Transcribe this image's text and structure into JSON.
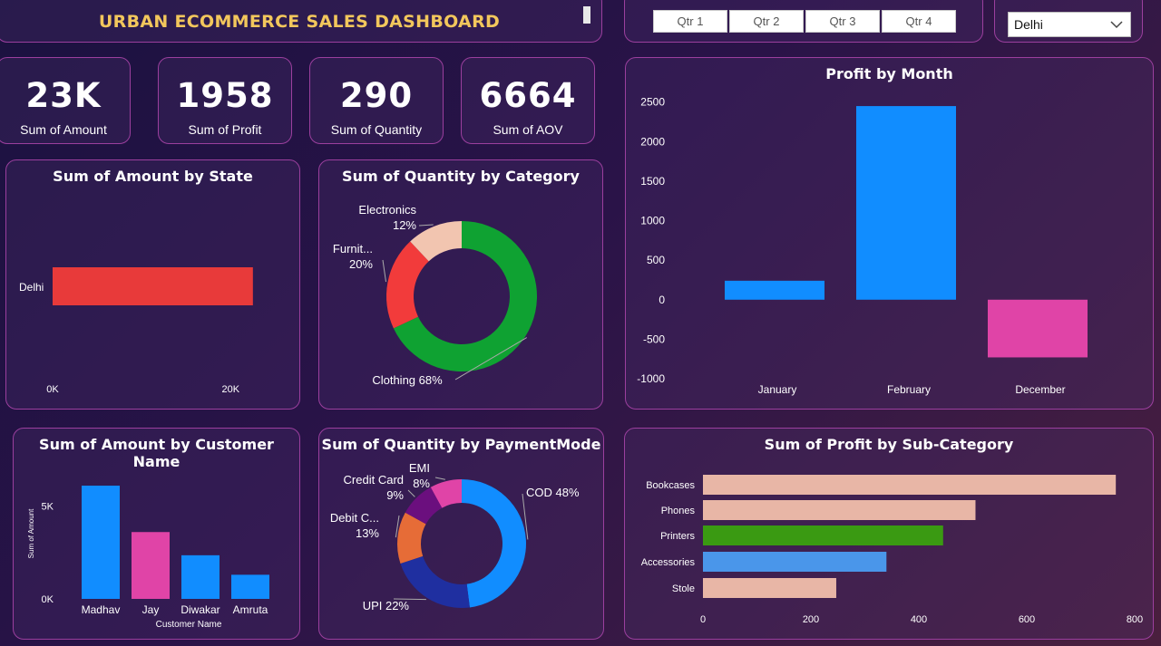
{
  "header": {
    "title": "URBAN ECOMMERCE SALES DASHBOARD",
    "quarters": [
      "Qtr 1",
      "Qtr 2",
      "Qtr 3",
      "Qtr 4"
    ],
    "city_selected": "Delhi"
  },
  "kpis": [
    {
      "value": "23K",
      "label": "Sum of Amount"
    },
    {
      "value": "1958",
      "label": "Sum of Profit"
    },
    {
      "value": "290",
      "label": "Sum of Quantity"
    },
    {
      "value": "6664",
      "label": "Sum of AOV"
    }
  ],
  "colors": {
    "blue": "#118dff",
    "pink": "#e044a7",
    "red": "#e83a3a",
    "green": "#0fa232",
    "peach": "#f2c5b0",
    "title_gold": "#f2c75c"
  },
  "chart_data": [
    {
      "id": "state",
      "type": "bar",
      "orientation": "horizontal",
      "title": "Sum of Amount by State",
      "categories": [
        "Delhi"
      ],
      "values": [
        22500
      ],
      "xlim": [
        0,
        27000
      ],
      "xticks": [
        {
          "v": 0,
          "label": "0K"
        },
        {
          "v": 20000,
          "label": "20K"
        }
      ],
      "colors": [
        "#e83a3a"
      ]
    },
    {
      "id": "category",
      "type": "pie",
      "donut": true,
      "title": "Sum of Quantity by Category",
      "slices": [
        {
          "name": "Clothing",
          "pct": 68,
          "label": "Clothing 68%",
          "color": "#0fa232"
        },
        {
          "name": "Furnit...",
          "pct": 20,
          "label": "20%",
          "color": "#f23b3b"
        },
        {
          "name": "Electronics",
          "pct": 12,
          "label": "12%",
          "color": "#f2c5b0"
        }
      ]
    },
    {
      "id": "month",
      "type": "bar",
      "title": "Profit by Month",
      "categories": [
        "January",
        "February",
        "December"
      ],
      "values": [
        240,
        2450,
        -730
      ],
      "ylim": [
        -1000,
        2600
      ],
      "yticks": [
        2500,
        2000,
        1500,
        1000,
        500,
        0,
        -500,
        -1000
      ],
      "colors": [
        "#118dff",
        "#118dff",
        "#e044a7"
      ]
    },
    {
      "id": "customer",
      "type": "bar",
      "title": "Sum of Amount by Customer Name",
      "xlabel": "Customer Name",
      "ylabel": "Sum of Amount",
      "categories": [
        "Madhav",
        "Jay",
        "Diwakar",
        "Amruta"
      ],
      "values": [
        6100,
        3600,
        2350,
        1300
      ],
      "ylim": [
        0,
        8200
      ],
      "yticks": [
        {
          "v": 0,
          "label": "0K"
        },
        {
          "v": 5000,
          "label": "5K"
        }
      ],
      "colors": [
        "#118dff",
        "#e044a7",
        "#118dff",
        "#118dff"
      ]
    },
    {
      "id": "payment",
      "type": "pie",
      "donut": true,
      "title": "Sum of Quantity by PaymentMode",
      "slices": [
        {
          "name": "COD",
          "pct": 48,
          "label": "COD 48%",
          "color": "#118dff"
        },
        {
          "name": "UPI",
          "pct": 22,
          "label": "UPI 22%",
          "color": "#1f2fa0"
        },
        {
          "name": "Debit C...",
          "pct": 13,
          "label": "13%",
          "color": "#e66c37"
        },
        {
          "name": "Credit Card",
          "pct": 9,
          "label": "9%",
          "color": "#6b0f7e"
        },
        {
          "name": "EMI",
          "pct": 8,
          "label": "8%",
          "color": "#e044a7"
        }
      ]
    },
    {
      "id": "subcategory",
      "type": "bar",
      "orientation": "horizontal",
      "title": "Sum of Profit by Sub-Category",
      "categories": [
        "Bookcases",
        "Phones",
        "Printers",
        "Accessories",
        "Stole"
      ],
      "values": [
        765,
        505,
        445,
        340,
        247
      ],
      "xlim": [
        0,
        800
      ],
      "xticks": [
        0,
        200,
        400,
        600,
        800
      ],
      "colors": [
        "#e8b6a6",
        "#e8b6a6",
        "#3a9a12",
        "#4a96ea",
        "#e8b6a6"
      ]
    }
  ]
}
